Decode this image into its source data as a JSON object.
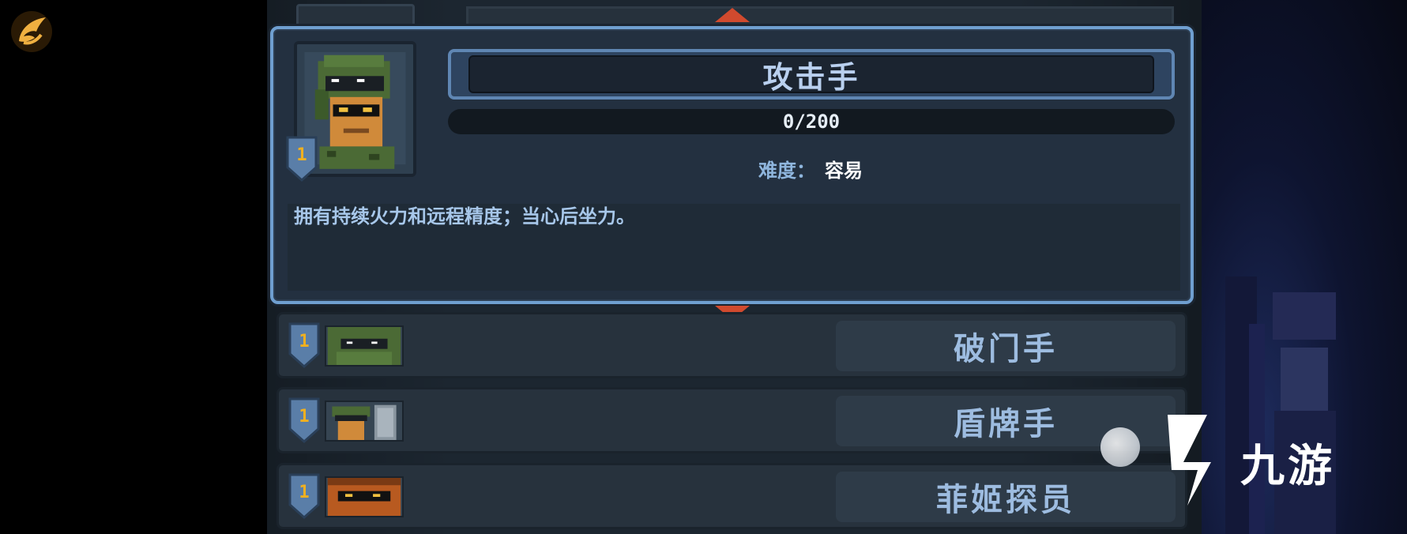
{
  "header": {
    "hidden_title": "攻击手"
  },
  "selected": {
    "name": "攻击手",
    "rank": "1",
    "progress_text": "0/200",
    "progress_fraction": 0,
    "difficulty_label": "难度：",
    "difficulty_value": "容易",
    "description": "拥有持续火力和远程精度；当心后坐力。"
  },
  "list": [
    {
      "rank": "1",
      "name": "破门手"
    },
    {
      "rank": "1",
      "name": "盾牌手"
    },
    {
      "rank": "1",
      "name": "菲姬探员"
    }
  ],
  "watermark": {
    "text": "九游",
    "icon": "jiuyou-logo-icon"
  },
  "colors": {
    "accent": "#6f9fd0",
    "arrow": "#d14a2e",
    "rank": "#f0b020",
    "panel": "#233040"
  }
}
